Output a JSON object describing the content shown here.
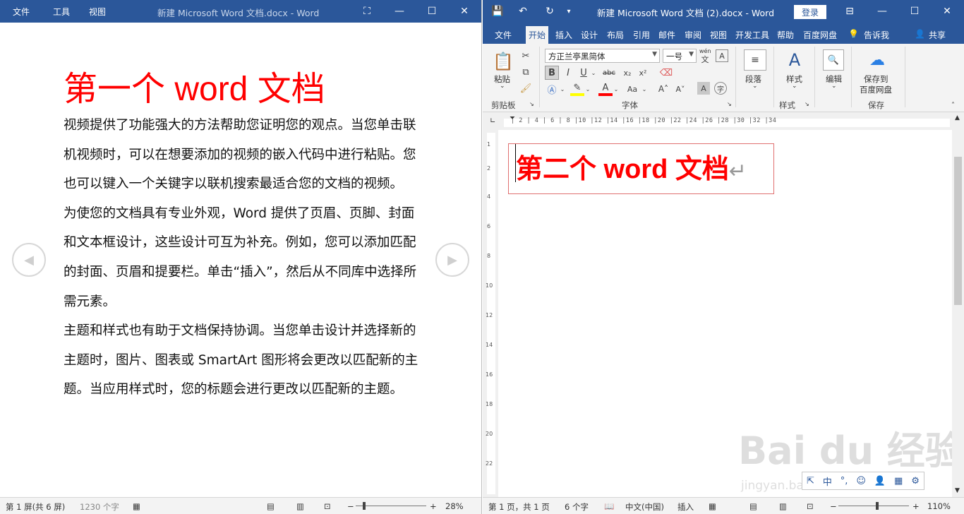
{
  "left_window": {
    "menu": [
      "文件",
      "工具",
      "视图"
    ],
    "title": "新建 Microsoft Word 文档.docx  -  Word",
    "doc_title": "第一个 word 文档",
    "paragraphs": [
      "视频提供了功能强大的方法帮助您证明您的观点。当您单击联机视频时，可以在想要添加的视频的嵌入代码中进行粘贴。您也可以键入一个关键字以联机搜索最适合您的文档的视频。",
      "为使您的文档具有专业外观，Word 提供了页眉、页脚、封面和文本框设计，这些设计可互为补充。例如，您可以添加匹配的封面、页眉和提要栏。单击“插入”，然后从不同库中选择所需元素。",
      "主题和样式也有助于文档保持协调。当您单击设计并选择新的主题时，图片、图表或 SmartArt 图形将会更改以匹配新的主题。当应用样式时，您的标题会进行更改以匹配新的主题。"
    ],
    "status": {
      "screen": "第 1 屏(共 6 屏)",
      "words": "1230 个字",
      "zoom": "28%",
      "zoom_fraction": 0.28
    }
  },
  "right_window": {
    "title": "新建 Microsoft Word 文档 (2).docx  -  Word",
    "login": "登录",
    "tabs": [
      "文件",
      "开始",
      "插入",
      "设计",
      "布局",
      "引用",
      "邮件",
      "审阅",
      "视图",
      "开发工具",
      "帮助",
      "百度网盘"
    ],
    "active_tab": "开始",
    "tell_me": "告诉我",
    "share": "共享",
    "ribbon": {
      "paste": "粘贴",
      "clipboard": "剪贴板",
      "font_name": "方正兰亭黑简体",
      "font_size": "一号",
      "phonetic": "wén",
      "font_group": "字体",
      "paragraph": "段落",
      "styles": "样式",
      "styles_group": "样式",
      "edit": "编辑",
      "save_baidu_1": "保存到",
      "save_baidu_2": "百度网盘",
      "save_group": "保存"
    },
    "ruler_text": "| 2 | 4 | 6 | 8 |10 |12 |14 |16 |18 |20 |22 |24 |26 |28 |30 |32 |34",
    "vruler": [
      "1",
      "2",
      "4",
      "6",
      "8",
      "10",
      "12",
      "14",
      "16",
      "18",
      "20",
      "22"
    ],
    "doc_title": "第二个 word 文档",
    "status": {
      "page": "第 1 页，共 1 页",
      "words": "6 个字",
      "language": "中文(中国)",
      "insert": "插入",
      "zoom": "110%",
      "zoom_fraction": 0.55
    },
    "mini_toolbar": [
      "中",
      "☺",
      "⚙"
    ]
  },
  "watermark": {
    "brand": "Bai du 经验",
    "url": "jingyan.baidu.com"
  },
  "colors": {
    "word_blue": "#2b579a",
    "title_red": "#ff0000"
  }
}
